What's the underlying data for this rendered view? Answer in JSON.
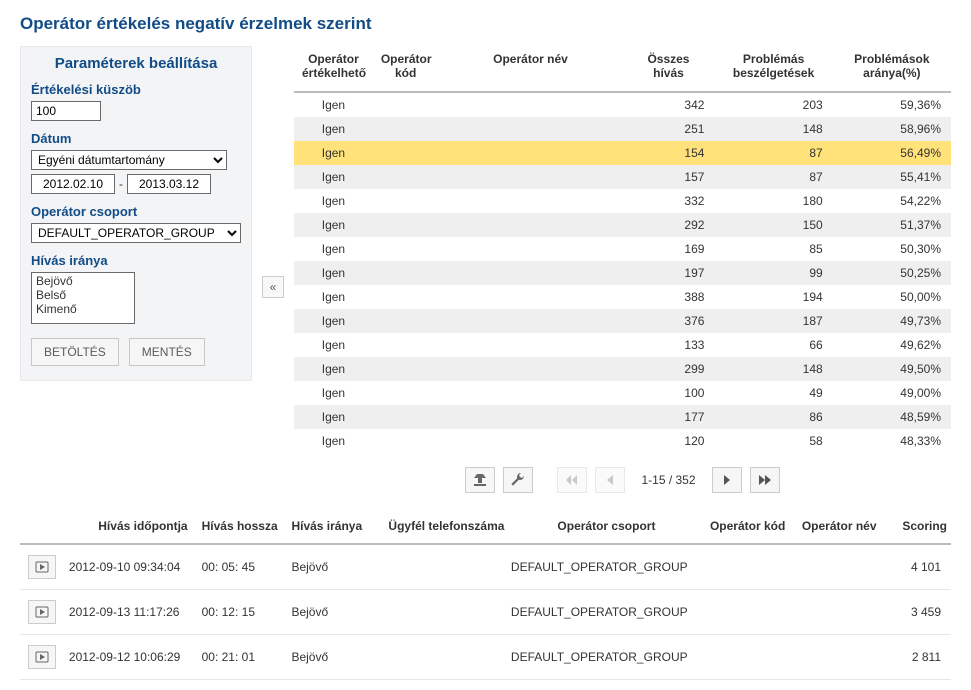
{
  "page": {
    "title": "Operátor értékelés negatív érzelmek szerint"
  },
  "sidebar": {
    "title": "Paraméterek beállítása",
    "threshold_label": "Értékelési küszöb",
    "threshold_value": "100",
    "date_label": "Dátum",
    "date_range_option": "Egyéni dátumtartomány",
    "date_from": "2012.02.10",
    "date_sep": "-",
    "date_to": "2013.03.12",
    "group_label": "Operátor csoport",
    "group_value": "DEFAULT_OPERATOR_GROUP",
    "direction_label": "Hívás iránya",
    "direction_options": [
      "Bejövő",
      "Belső",
      "Kimenő"
    ],
    "btn_load": "BETÖLTÉS",
    "btn_save": "MENTÉS"
  },
  "collapse_glyph": "«",
  "ops_table": {
    "headers": {
      "evaluable": "Operátor értékelhető",
      "op_code": "Operátor kód",
      "op_name": "Operátor név",
      "total_calls": "Összes hívás",
      "problem_talks": "Problémás beszélgetések",
      "problem_pct": "Problémások aránya(%)"
    },
    "rows": [
      {
        "evaluable": "Igen",
        "op_code": "",
        "op_name": "",
        "calls": "342",
        "prob": "203",
        "pct": "59,36%",
        "row": "odd"
      },
      {
        "evaluable": "Igen",
        "op_code": "",
        "op_name": "",
        "calls": "251",
        "prob": "148",
        "pct": "58,96%",
        "row": "even"
      },
      {
        "evaluable": "Igen",
        "op_code": "",
        "op_name": "",
        "calls": "154",
        "prob": "87",
        "pct": "56,49%",
        "row": "hl"
      },
      {
        "evaluable": "Igen",
        "op_code": "",
        "op_name": "",
        "calls": "157",
        "prob": "87",
        "pct": "55,41%",
        "row": "even"
      },
      {
        "evaluable": "Igen",
        "op_code": "",
        "op_name": "",
        "calls": "332",
        "prob": "180",
        "pct": "54,22%",
        "row": "odd"
      },
      {
        "evaluable": "Igen",
        "op_code": "",
        "op_name": "",
        "calls": "292",
        "prob": "150",
        "pct": "51,37%",
        "row": "even"
      },
      {
        "evaluable": "Igen",
        "op_code": "",
        "op_name": "",
        "calls": "169",
        "prob": "85",
        "pct": "50,30%",
        "row": "odd"
      },
      {
        "evaluable": "Igen",
        "op_code": "",
        "op_name": "",
        "calls": "197",
        "prob": "99",
        "pct": "50,25%",
        "row": "even"
      },
      {
        "evaluable": "Igen",
        "op_code": "",
        "op_name": "",
        "calls": "388",
        "prob": "194",
        "pct": "50,00%",
        "row": "odd"
      },
      {
        "evaluable": "Igen",
        "op_code": "",
        "op_name": "",
        "calls": "376",
        "prob": "187",
        "pct": "49,73%",
        "row": "even"
      },
      {
        "evaluable": "Igen",
        "op_code": "",
        "op_name": "",
        "calls": "133",
        "prob": "66",
        "pct": "49,62%",
        "row": "odd"
      },
      {
        "evaluable": "Igen",
        "op_code": "",
        "op_name": "",
        "calls": "299",
        "prob": "148",
        "pct": "49,50%",
        "row": "even"
      },
      {
        "evaluable": "Igen",
        "op_code": "",
        "op_name": "",
        "calls": "100",
        "prob": "49",
        "pct": "49,00%",
        "row": "odd"
      },
      {
        "evaluable": "Igen",
        "op_code": "",
        "op_name": "",
        "calls": "177",
        "prob": "86",
        "pct": "48,59%",
        "row": "even"
      },
      {
        "evaluable": "Igen",
        "op_code": "",
        "op_name": "",
        "calls": "120",
        "prob": "58",
        "pct": "48,33%",
        "row": "odd"
      }
    ]
  },
  "pager": {
    "label": "1-15 / 352"
  },
  "calls_table": {
    "headers": {
      "time": "Hívás időpontja",
      "length": "Hívás hossza",
      "direction": "Hívás iránya",
      "phone": "Ügyfél telefonszáma",
      "group": "Operátor csoport",
      "op_code": "Operátor kód",
      "op_name": "Operátor név",
      "scoring": "Scoring"
    },
    "rows": [
      {
        "time": "2012-09-10 09:34:04",
        "len": "00: 05: 45",
        "dir": "Bejövő",
        "phone": "",
        "group": "DEFAULT_OPERATOR_GROUP",
        "code": "",
        "name": "",
        "score": "4 101"
      },
      {
        "time": "2012-09-13 11:17:26",
        "len": "00: 12: 15",
        "dir": "Bejövő",
        "phone": "",
        "group": "DEFAULT_OPERATOR_GROUP",
        "code": "",
        "name": "",
        "score": "3 459"
      },
      {
        "time": "2012-09-12 10:06:29",
        "len": "00: 21: 01",
        "dir": "Bejövő",
        "phone": "",
        "group": "DEFAULT_OPERATOR_GROUP",
        "code": "",
        "name": "",
        "score": "2 811"
      }
    ]
  },
  "icons": {
    "export": "export-icon",
    "tools": "wrench-icon",
    "first": "first-page-icon",
    "prev": "prev-page-icon",
    "next": "next-page-icon",
    "last": "last-page-icon",
    "play": "play-icon"
  }
}
